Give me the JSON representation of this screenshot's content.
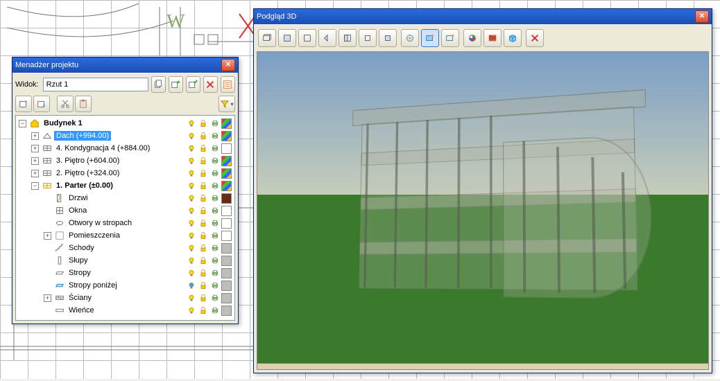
{
  "preview3d": {
    "title": "Podgląd 3D",
    "toolbar": [
      {
        "name": "view-persp-icon",
        "tip": "persp"
      },
      {
        "name": "view-front-icon",
        "tip": "front"
      },
      {
        "name": "view-back-icon",
        "tip": "back"
      },
      {
        "name": "view-left-icon",
        "tip": "left"
      },
      {
        "name": "view-right-icon",
        "tip": "right"
      },
      {
        "name": "view-top-icon",
        "tip": "top"
      },
      {
        "name": "view-bottom-icon",
        "tip": "bottom"
      }
    ]
  },
  "pm": {
    "title": "Menadżer projektu",
    "view_label": "Widok:",
    "view_value": "Rzut 1",
    "tree": [
      {
        "depth": 0,
        "exp": "-",
        "icon": "building",
        "label": "Budynek 1",
        "bold": true,
        "bulb": "on",
        "lock": true,
        "print": true,
        "swatch": "multi"
      },
      {
        "depth": 1,
        "exp": "+",
        "icon": "roof",
        "label": "Dach (+994.00)",
        "sel": true,
        "bulb": "on",
        "lock": true,
        "print": true,
        "swatch": "multi"
      },
      {
        "depth": 1,
        "exp": "+",
        "icon": "storey",
        "label": "4. Kondygnacja 4 (+884.00)",
        "bulb": "on",
        "lock": true,
        "print": true,
        "swatch": "#ffffff"
      },
      {
        "depth": 1,
        "exp": "+",
        "icon": "storey",
        "label": "3. Piętro (+604.00)",
        "bulb": "on",
        "lock": true,
        "print": true,
        "swatch": "multi"
      },
      {
        "depth": 1,
        "exp": "+",
        "icon": "storey",
        "label": "2. Piętro (+324.00)",
        "bulb": "on",
        "lock": true,
        "print": true,
        "swatch": "multi"
      },
      {
        "depth": 1,
        "exp": "-",
        "icon": "storey-active",
        "label": "1. Parter (±0.00)",
        "bold": true,
        "bulb": "on",
        "lock": true,
        "print": true,
        "swatch": "multi"
      },
      {
        "depth": 2,
        "exp": "",
        "icon": "door",
        "label": "Drzwi",
        "bulb": "on",
        "lock": true,
        "print": true,
        "swatch": "#6b2a12"
      },
      {
        "depth": 2,
        "exp": "",
        "icon": "window",
        "label": "Okna",
        "bulb": "on",
        "lock": true,
        "print": true,
        "swatch": "#ffffff"
      },
      {
        "depth": 2,
        "exp": "",
        "icon": "opening",
        "label": "Otwory w stropach",
        "bulb": "on",
        "lock": true,
        "print": true,
        "swatch": "#ffffff"
      },
      {
        "depth": 2,
        "exp": "+",
        "icon": "room",
        "label": "Pomieszczenia",
        "bulb": "on",
        "lock": true,
        "print": true,
        "swatch": "#ffffff"
      },
      {
        "depth": 2,
        "exp": "",
        "icon": "stairs",
        "label": "Schody",
        "bulb": "on",
        "lock": true,
        "print": true,
        "swatch": "#bdbdbd"
      },
      {
        "depth": 2,
        "exp": "",
        "icon": "column",
        "label": "Słupy",
        "bulb": "on",
        "lock": true,
        "print": true,
        "swatch": "#bdbdbd"
      },
      {
        "depth": 2,
        "exp": "",
        "icon": "slab",
        "label": "Stropy",
        "bulb": "on",
        "lock": true,
        "print": true,
        "swatch": "#bdbdbd"
      },
      {
        "depth": 2,
        "exp": "",
        "icon": "slab-below",
        "label": "Stropy poniżej",
        "bulb": "blue",
        "lock": true,
        "print": true,
        "swatch": "#bdbdbd"
      },
      {
        "depth": 2,
        "exp": "+",
        "icon": "wall",
        "label": "Ściany",
        "bulb": "on",
        "lock": true,
        "print": true,
        "swatch": "#bdbdbd"
      },
      {
        "depth": 2,
        "exp": "",
        "icon": "beam",
        "label": "Wieńce",
        "bulb": "on",
        "lock": true,
        "print": true,
        "swatch": "#bdbdbd"
      }
    ]
  }
}
